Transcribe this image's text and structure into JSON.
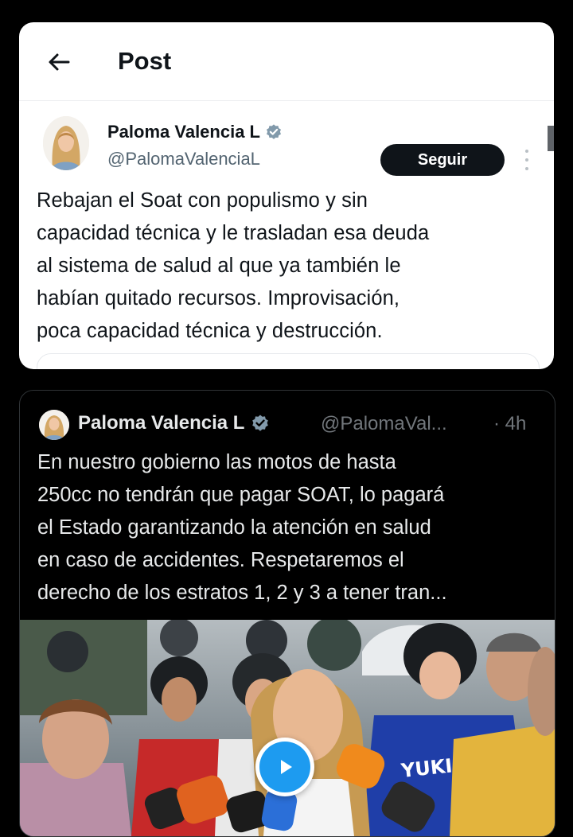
{
  "header": {
    "title": "Post"
  },
  "author": {
    "name": "Paloma Valencia L",
    "handle": "@PalomaValenciaL",
    "follow_label": "Seguir"
  },
  "post": {
    "text_lines": [
      "Rebajan el Soat con populismo y sin",
      "capacidad técnica y le trasladan esa deuda",
      "al sistema de salud al que ya también le",
      "habían quitado recursos. Improvisación,",
      "poca capacidad técnica y destrucción."
    ]
  },
  "quoted": {
    "name": "Paloma Valencia L",
    "handle": "@PalomaVal...",
    "time": "· 4h",
    "text_lines": [
      "En nuestro gobierno las motos  de hasta",
      "250cc no tendrán que pagar SOAT, lo pagará",
      "el Estado garantizando la atención en salud",
      "en caso de accidentes. Respetaremos el",
      "derecho de los estratos 1, 2 y 3 a tener tran..."
    ],
    "media": {
      "type": "video",
      "icon": "play-icon",
      "helmet_text": "YUKI"
    }
  },
  "colors": {
    "accent": "#1d9bf0",
    "verified": "#829aab",
    "follow_bg": "#0f1419",
    "card_bg": "#ffffff",
    "dark_bg": "#000000"
  }
}
